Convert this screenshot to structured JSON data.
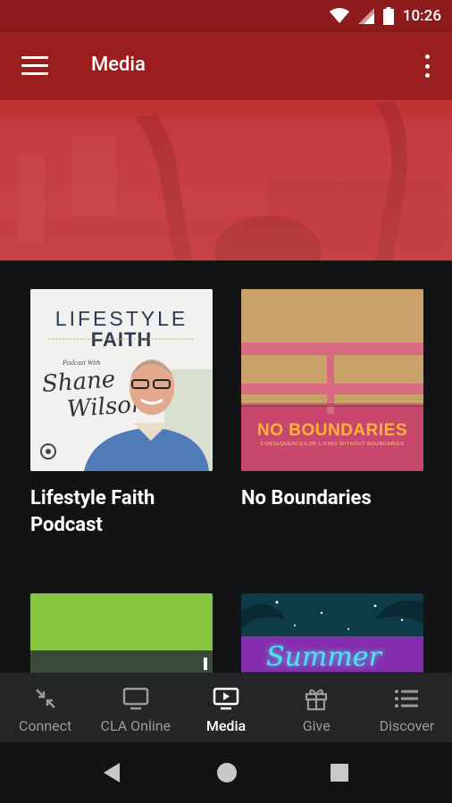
{
  "status": {
    "time": "10:26"
  },
  "appbar": {
    "title": "Media"
  },
  "cards": [
    {
      "label": "Lifestyle Faith\nPodcast",
      "label_line1": "Lifestyle Faith",
      "label_line2": "Podcast",
      "art": {
        "top": "LIFESTYLE",
        "faith": "FAITH",
        "podcast_with": "Podcast With",
        "name_line1": "Shane",
        "name_line2": "Wilson"
      }
    },
    {
      "label": "No Boundaries",
      "art": {
        "title": "NO BOUNDARIES",
        "subtitle": "CONSEQUENCES OF LIVING WITHOUT BOUNDARIES"
      }
    },
    {
      "label": "",
      "art": {}
    },
    {
      "label": "",
      "art": {
        "title": "Summer"
      }
    }
  ],
  "bottom_nav": [
    {
      "label": "Connect",
      "icon": "collapse-arrows-icon",
      "active": false
    },
    {
      "label": "CLA Online",
      "icon": "tv-icon",
      "active": false
    },
    {
      "label": "Media",
      "icon": "play-screen-icon",
      "active": true
    },
    {
      "label": "Give",
      "icon": "gift-icon",
      "active": false
    },
    {
      "label": "Discover",
      "icon": "list-icon",
      "active": false
    }
  ],
  "colors": {
    "appbar": "#9a1e1e",
    "statusbar": "#8e1b1b",
    "background": "#121314",
    "bottom_nav": "#242527"
  }
}
